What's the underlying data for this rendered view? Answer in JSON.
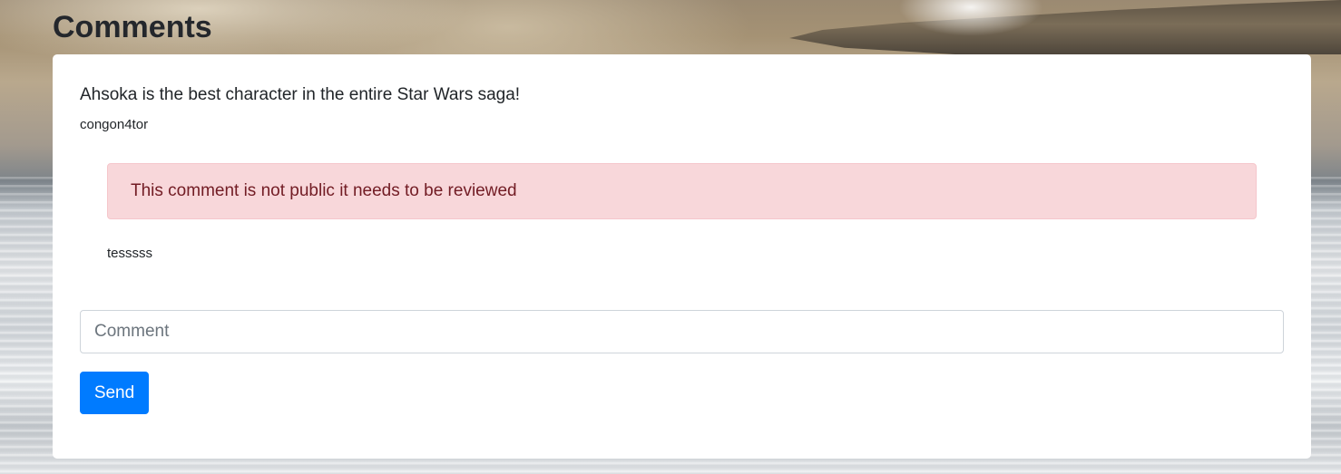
{
  "page": {
    "title": "Comments"
  },
  "comment": {
    "text": "Ahsoka is the best character in the entire Star Wars saga!",
    "author": "congon4tor",
    "alert": "This comment is not public it needs to be reviewed",
    "reply": "tesssss"
  },
  "form": {
    "placeholder": "Comment",
    "value": "",
    "send_label": "Send"
  },
  "colors": {
    "primary": "#007bff",
    "alert_bg": "#f8d7da",
    "alert_text": "#721c24"
  }
}
